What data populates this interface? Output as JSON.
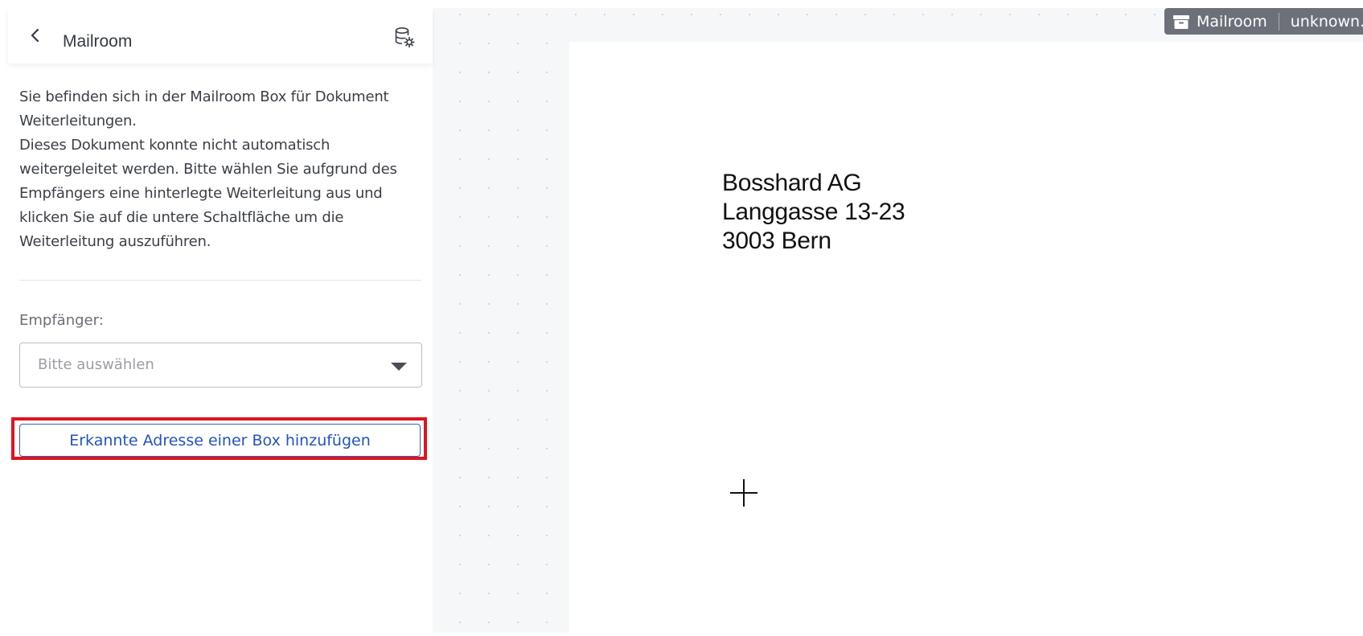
{
  "header": {
    "title": "Mailroom",
    "back_icon": "chevron-left-icon",
    "settings_icon": "database-settings-icon"
  },
  "description": {
    "paragraph1": "Sie befinden sich in der Mailroom Box für Dokument Weiterleitungen.",
    "paragraph2": "Dieses Dokument konnte nicht automatisch weitergeleitet werden. Bitte wählen Sie aufgrund des Empfängers eine hinterlegte Weiterleitung aus und klicken Sie auf die untere Schaltfläche um die Weiterleitung auszuführen."
  },
  "recipient": {
    "label": "Empfänger:",
    "placeholder": "Bitte auswählen"
  },
  "actions": {
    "add_address_label": "Erkannte Adresse einer Box hinzufügen"
  },
  "document": {
    "address_lines": [
      "Bosshard AG",
      "Langgasse 13-23",
      "3003 Bern"
    ]
  },
  "tag": {
    "box_name": "Mailroom",
    "status": "unknown.",
    "icon": "inbox-icon"
  },
  "colors": {
    "accent": "#2353c0",
    "highlight": "#e0131e",
    "canvas_bg": "#f6f7f9",
    "tag_bg": "#6c7078"
  }
}
